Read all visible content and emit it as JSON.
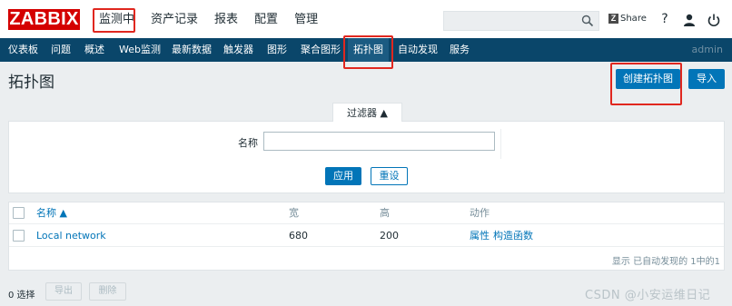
{
  "header": {
    "logo": "ZABBIX",
    "menu": [
      "监测中",
      "资产记录",
      "报表",
      "配置",
      "管理"
    ],
    "share_label": "Share",
    "help": "?",
    "search_placeholder": ""
  },
  "submenu": {
    "items": [
      "仪表板",
      "问题",
      "概述",
      "Web监测",
      "最新数据",
      "触发器",
      "图形",
      "聚合图形",
      "拓扑图",
      "自动发现",
      "服务"
    ],
    "active": "拓扑图",
    "user": "admin"
  },
  "page": {
    "title": "拓扑图",
    "create_button": "创建拓扑图",
    "import_button": "导入"
  },
  "filter": {
    "tab_label": "过滤器 ▲",
    "name_label": "名称",
    "name_value": "",
    "apply_button": "应用",
    "reset_button": "重设"
  },
  "table": {
    "columns": [
      "名称 ▲",
      "宽",
      "高",
      "动作"
    ],
    "rows": [
      {
        "name": "Local network",
        "width": "680",
        "height": "200",
        "action_props": "属性",
        "action_constructor": "构造函数"
      }
    ],
    "footer": "显示 已自动发现的 1中的1"
  },
  "bottom": {
    "selected": "0 选择",
    "export_button": "导出",
    "delete_button": "删除"
  },
  "watermark": "CSDN @小安运维日记",
  "colors": {
    "brand": "#d40000",
    "submenu_bg": "#0a466a",
    "primary": "#0275b8",
    "highlight": "#e0271f"
  }
}
